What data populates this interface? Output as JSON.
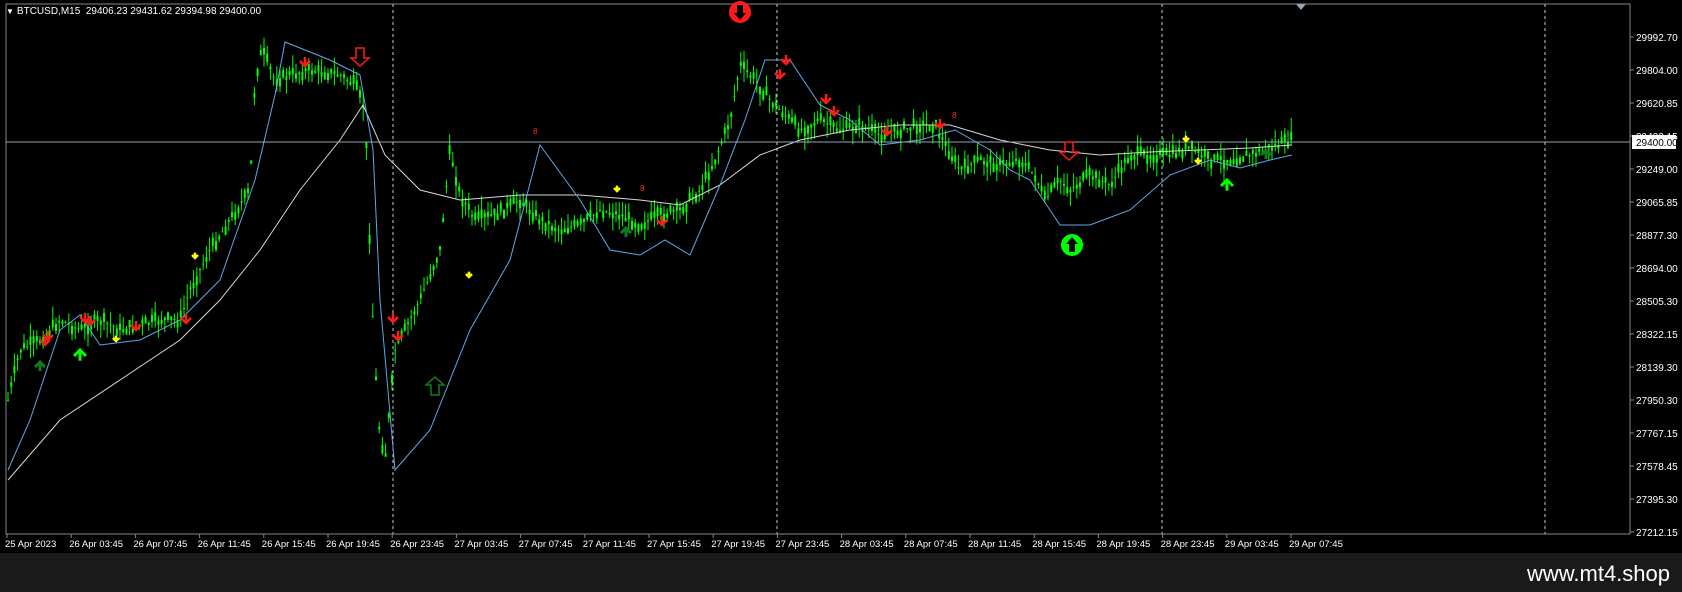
{
  "chart": {
    "symbol_label": "BTCUSD,M15",
    "ohlc_label": "29406.23 29431.62 29394.98 29400.00",
    "current_price": "29400.00",
    "price_labels": [
      "29992.70",
      "29804.00",
      "29620.85",
      "29432.15",
      "29249.00",
      "29065.85",
      "28877.30",
      "28694.00",
      "28505.30",
      "28322.15",
      "28139.30",
      "27950.30",
      "27767.15",
      "27578.45",
      "27395.30",
      "27212.15"
    ],
    "time_labels": [
      "25 Apr 2023",
      "26 Apr 03:45",
      "26 Apr 07:45",
      "26 Apr 11:45",
      "26 Apr 15:45",
      "26 Apr 19:45",
      "26 Apr 23:45",
      "27 Apr 03:45",
      "27 Apr 07:45",
      "27 Apr 11:45",
      "27 Apr 15:45",
      "27 Apr 19:45",
      "27 Apr 23:45",
      "28 Apr 03:45",
      "28 Apr 07:45",
      "28 Apr 11:45",
      "28 Apr 15:45",
      "28 Apr 19:45",
      "28 Apr 23:45",
      "29 Apr 03:45",
      "29 Apr 07:45"
    ],
    "small_red_markers": [
      "8",
      "8",
      "8"
    ],
    "colors": {
      "background": "#000000",
      "candles": "#00ff00",
      "price_line": "#8fa6b9",
      "slow_ma": "#d9d9d9",
      "fast_ma": "#5fa8e6",
      "sell_arrow": "#ff1a1a",
      "buy_arrow": "#00ff00",
      "yellow_arrow": "#ffff00",
      "dark_green_arrow": "#0f7d1c"
    }
  },
  "footer": {
    "watermark": "www.mt4.shop"
  }
}
